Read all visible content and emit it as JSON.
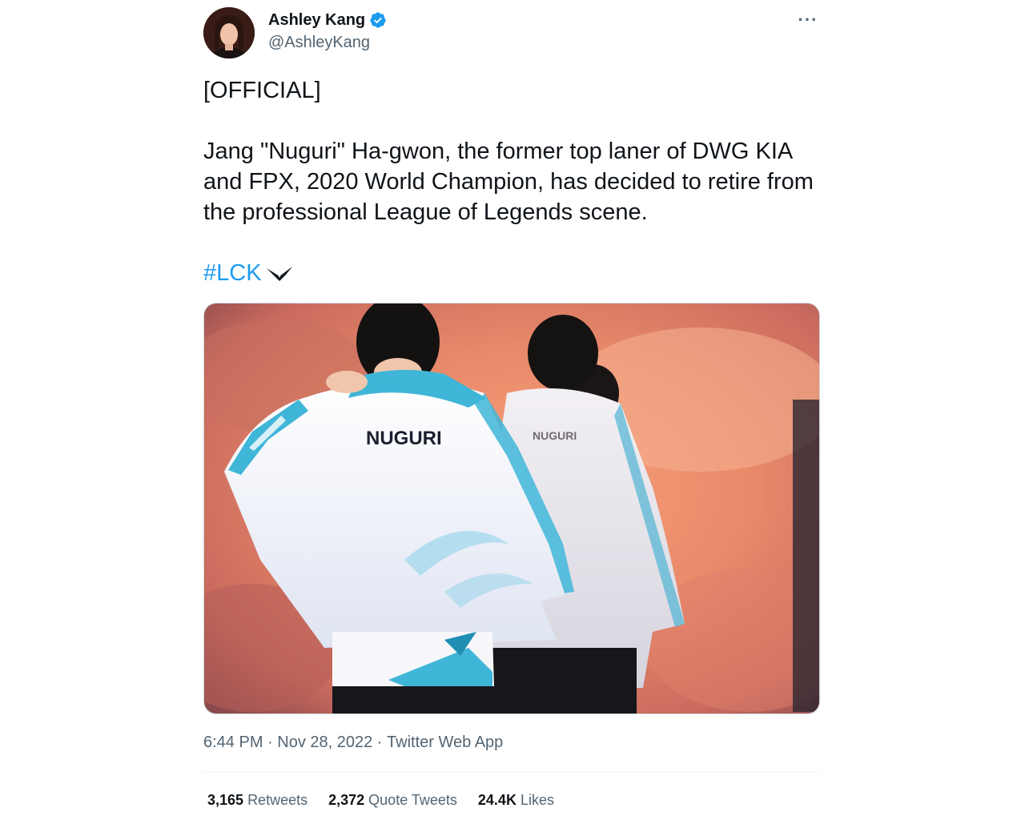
{
  "author": {
    "display_name": "Ashley Kang",
    "handle": "@AshleyKang",
    "verified_icon": "verified-badge-icon",
    "avatar": "avatar"
  },
  "more_icon": "more-options-icon",
  "tweet": {
    "official": "[OFFICIAL]",
    "body": "Jang \"Nuguri\" Ha-gwon, the former top laner of DWG KIA and FPX, 2020 World Champion, has decided to retire from the professional League of Legends scene.",
    "hashtag": "#LCK",
    "hashflag_icon": "lck-hashflag-icon",
    "image_text": "NUGURI"
  },
  "meta": {
    "time": "6:44 PM",
    "sep1": " · ",
    "date": "Nov 28, 2022",
    "sep2": " · ",
    "source": "Twitter Web App"
  },
  "stats": {
    "retweets_count": "3,165",
    "retweets_label": "Retweets",
    "quotes_count": "2,372",
    "quotes_label": "Quote Tweets",
    "likes_count": "24.4K",
    "likes_label": "Likes"
  },
  "colors": {
    "link": "#1d9bf0",
    "text": "#0f1419",
    "secondary": "#536471",
    "border": "#cfd9de"
  }
}
